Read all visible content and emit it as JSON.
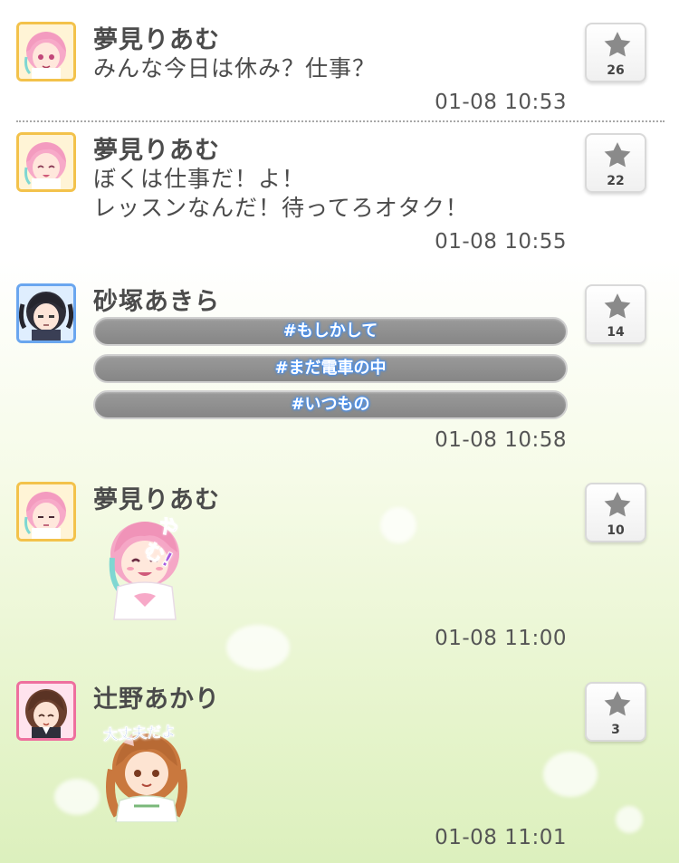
{
  "messages": [
    {
      "name": "夢見りあむ",
      "text": [
        "みんな今日は休み？仕事？"
      ],
      "time": "01-08 10:53",
      "stars": "26"
    },
    {
      "name": "夢見りあむ",
      "text": [
        "ぼくは仕事だ！よ！",
        "レッスンなんだ！待ってろオタク！"
      ],
      "time": "01-08 10:55",
      "stars": "22"
    },
    {
      "name": "砂塚あきら",
      "tags": [
        "#もしかして",
        "#まだ電車の中",
        "#いつもの"
      ],
      "time": "01-08 10:58",
      "stars": "14"
    },
    {
      "name": "夢見りあむ",
      "sticker_text": "やむ!",
      "time": "01-08 11:00",
      "stars": "10"
    },
    {
      "name": "辻野あかり",
      "sticker_text": "大丈夫だよ",
      "time": "01-08 11:01",
      "stars": "3"
    }
  ],
  "colors": {
    "avatar_border_riamu": "#f3c24b",
    "avatar_border_akira": "#6aa6ef",
    "avatar_border_akari": "#ee6f9e",
    "tag_glow": "#3a8fff",
    "star_icon": "#8a8a8a"
  },
  "icons": {
    "star_button": "star-icon"
  }
}
